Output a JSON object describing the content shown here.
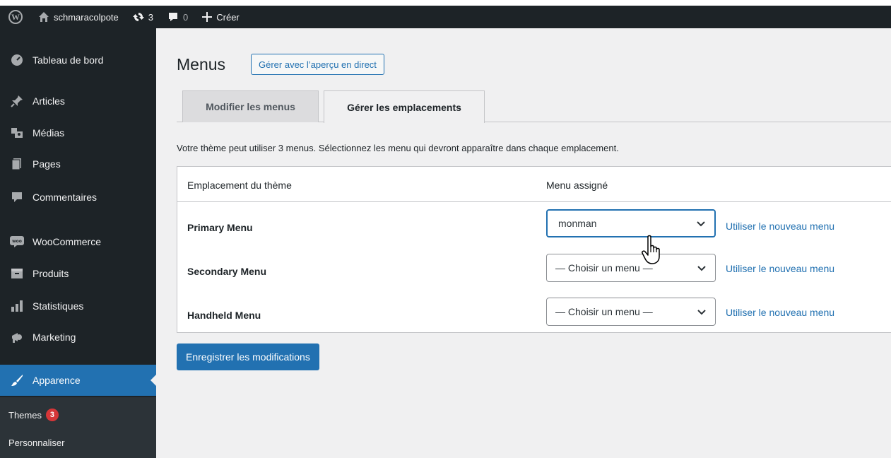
{
  "adminbar": {
    "site_name": "schmaracolpote",
    "updates_count": "3",
    "comments_count": "0",
    "new_label": "Créer"
  },
  "sidebar": {
    "items": [
      {
        "label": "Tableau de bord",
        "icon": "dashboard-icon"
      },
      {
        "label": "Articles",
        "icon": "pin-icon"
      },
      {
        "label": "Médias",
        "icon": "media-icon"
      },
      {
        "label": "Pages",
        "icon": "pages-icon"
      },
      {
        "label": "Commentaires",
        "icon": "comment-icon"
      },
      {
        "label": "WooCommerce",
        "icon": "woocommerce-icon"
      },
      {
        "label": "Produits",
        "icon": "products-icon"
      },
      {
        "label": "Statistiques",
        "icon": "stats-icon"
      },
      {
        "label": "Marketing",
        "icon": "megaphone-icon"
      },
      {
        "label": "Apparence",
        "icon": "brush-icon"
      }
    ],
    "submenu": [
      {
        "label": "Themes",
        "badge": "3"
      },
      {
        "label": "Personnaliser"
      }
    ]
  },
  "main": {
    "title": "Menus",
    "title_action": "Gérer avec l’aperçu en direct",
    "tabs": [
      {
        "label": "Modifier les menus"
      },
      {
        "label": "Gérer les emplacements"
      }
    ],
    "description": "Votre thème peut utiliser 3 menus. Sélectionnez les menu qui devront apparaître dans chaque emplacement.",
    "table": {
      "headers": [
        "Emplacement du thème",
        "Menu assigné"
      ],
      "rows": [
        {
          "location": "Primary Menu",
          "selected": "monman",
          "link": "Utiliser le nouveau menu"
        },
        {
          "location": "Secondary Menu",
          "selected": "— Choisir un menu —",
          "link": "Utiliser le nouveau menu"
        },
        {
          "location": "Handheld Menu",
          "selected": "— Choisir un menu —",
          "link": "Utiliser le nouveau menu"
        }
      ]
    },
    "save_label": "Enregistrer les modifications"
  },
  "colors": {
    "accent": "#2271b1",
    "admin_dark": "#1d2327",
    "badge": "#d63638"
  }
}
